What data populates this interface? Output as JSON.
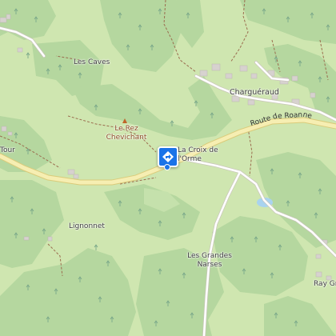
{
  "map": {
    "place_labels": {
      "les_caves": "Les Caves",
      "le_rez_chevichant": "Le Rez\nChevichant",
      "charguéraud": "Charguéraud",
      "la_croix_de_lorme": "La Croix de\nl'Orme",
      "tour": "Tour",
      "lignonnet": "Lignonnet",
      "les_grandes_narses": "Les Grandes\nNarses",
      "ray_gr": "Ray Gr"
    },
    "road_labels": {
      "route_de_roanne": "Route de Roanne"
    },
    "icons": {
      "peak": "peak-triangle-icon",
      "location": "directions-marker-icon"
    },
    "colors": {
      "forest": "#b0d49a",
      "meadow": "#cfe6b0",
      "road": "#f6eeb2",
      "road_edge": "#dacb7a",
      "minor_road": "#ffffff",
      "path": "#9b6d4f",
      "building": "#d7d2cf",
      "water": "#a9d3ef",
      "marker": "#1a73e8"
    }
  }
}
